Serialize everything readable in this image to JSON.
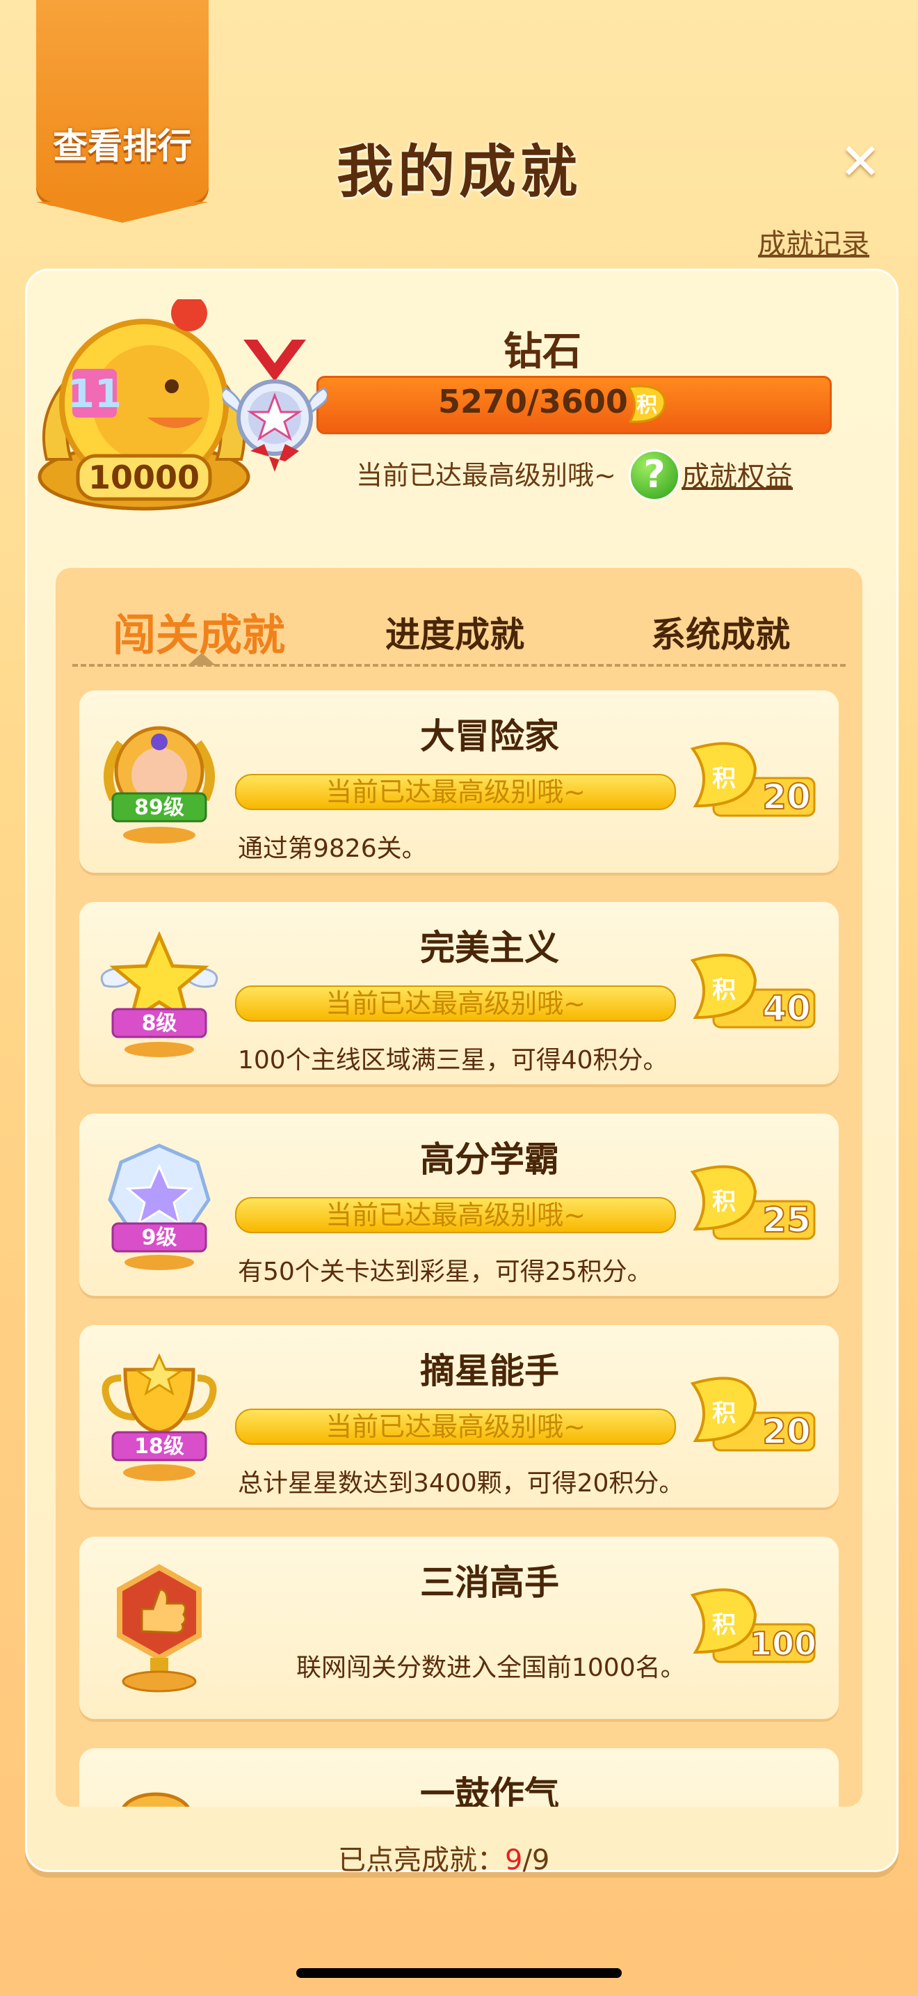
{
  "header": {
    "rank_button": "查看排行",
    "title": "我的成就",
    "close": "✕",
    "record_link": "成就记录"
  },
  "profile": {
    "avatar_score": "10000",
    "level_name": "钻石",
    "progress_text": "5270/3600",
    "coin_char": "积",
    "max_note": "当前已达最高级别哦~",
    "help_icon": "?",
    "benefit_link": "成就权益"
  },
  "tabs": [
    {
      "label": "闯关成就",
      "active": true
    },
    {
      "label": "进度成就",
      "active": false
    },
    {
      "label": "系统成就",
      "active": false
    }
  ],
  "items": [
    {
      "title": "大冒险家",
      "level": "89级",
      "bar": "当前已达最高级别哦~",
      "desc": "通过第9826关。",
      "reward": "20",
      "badge": "adventurer-badge",
      "ribbon": "#48B431"
    },
    {
      "title": "完美主义",
      "level": "8级",
      "bar": "当前已达最高级别哦~",
      "desc": "100个主线区域满三星，可得40积分。",
      "reward": "40",
      "badge": "winged-star-badge",
      "ribbon": "#D84FC9"
    },
    {
      "title": "高分学霸",
      "level": "9级",
      "bar": "当前已达最高级别哦~",
      "desc": "有50个关卡达到彩星，可得25积分。",
      "reward": "25",
      "badge": "crystal-star-badge",
      "ribbon": "#D84FC9"
    },
    {
      "title": "摘星能手",
      "level": "18级",
      "bar": "当前已达最高级别哦~",
      "desc": "总计星星数达到3400颗，可得20积分。",
      "reward": "20",
      "badge": "trophy-badge",
      "ribbon": "#D84FC9"
    },
    {
      "title": "三消高手",
      "level": "",
      "bar": "",
      "desc": "联网闯关分数进入全国前1000名。",
      "reward": "100",
      "badge": "thumbs-up-badge",
      "ribbon": ""
    },
    {
      "title": "一鼓作气",
      "level": "",
      "bar": "",
      "desc": "",
      "reward": "",
      "badge": "partial-badge",
      "ribbon": ""
    }
  ],
  "footer": {
    "label": "已点亮成就：",
    "current": "9",
    "total": "/9"
  }
}
